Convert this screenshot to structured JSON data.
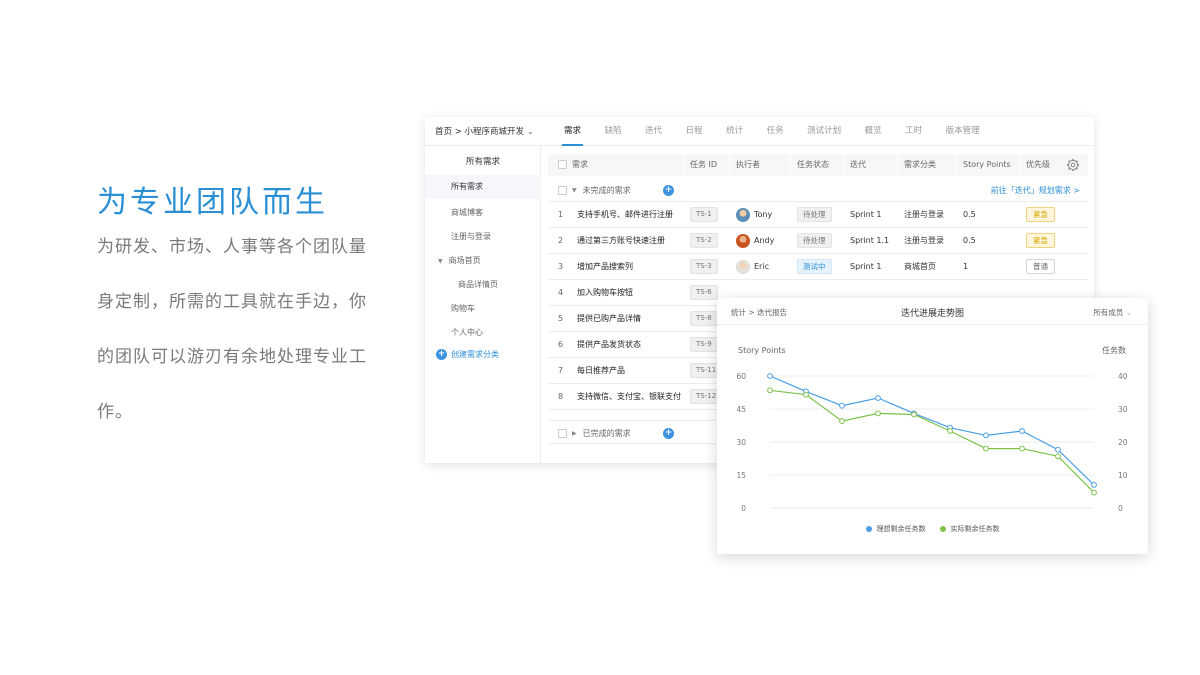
{
  "hero": {
    "title": "为专业团队而生",
    "body": "为研发、市场、人事等各个团队量身定制，所需的工具就在手边，你的团队可以游刃有余地处理专业工作。"
  },
  "app": {
    "project_breadcrumb": "首页 > 小程序商城开发",
    "nav_tabs": [
      "需求",
      "缺陷",
      "迭代",
      "日程",
      "统计",
      "任务",
      "测试计划",
      "概览",
      "工时",
      "版本管理"
    ],
    "active_tab": "需求",
    "sidebar": {
      "header": "所有需求",
      "items": [
        "所有需求",
        "商城博客",
        "注册与登录",
        "商场首页",
        "商品详情页",
        "购物车",
        "个人中心"
      ],
      "add_label": "创建需求分类"
    },
    "table": {
      "headers": [
        "需求",
        "任务 ID",
        "执行者",
        "任务状态",
        "迭代",
        "需求分类",
        "Story Points",
        "优先级"
      ],
      "group_incomplete": "未完成的需求",
      "group_link": "前往「迭代」规划需求 >",
      "group_complete": "已完成的需求",
      "rows": [
        {
          "no": "1",
          "name": "支持手机号、邮件进行注册",
          "id": "TS-1",
          "assignee": "Tony",
          "status": "待处理",
          "sprint": "Sprint 1",
          "category": "注册与登录",
          "points": "0.5",
          "priority": "紧急"
        },
        {
          "no": "2",
          "name": "通过第三方账号快速注册",
          "id": "TS-2",
          "assignee": "Andy",
          "status": "待处理",
          "sprint": "Sprint 1.1",
          "category": "注册与登录",
          "points": "0.5",
          "priority": "紧急"
        },
        {
          "no": "3",
          "name": "增加产品搜索列",
          "id": "TS-3",
          "assignee": "Eric",
          "status": "测试中",
          "sprint": "Sprint 1",
          "category": "商城首页",
          "points": "1",
          "priority": "普通"
        },
        {
          "no": "4",
          "name": "加入购物车按钮",
          "id": "TS-6"
        },
        {
          "no": "5",
          "name": "提供已购产品详情",
          "id": "TS-8"
        },
        {
          "no": "6",
          "name": "提供产品发货状态",
          "id": "TS-9"
        },
        {
          "no": "7",
          "name": "每日推荐产品",
          "id": "TS-11"
        },
        {
          "no": "8",
          "name": "支持微信、支付宝、银联支付",
          "id": "TS-12"
        }
      ]
    }
  },
  "chart_card": {
    "breadcrumb": "统计 > 迭代报告",
    "title": "迭代进展走势图",
    "filter": "所有成员"
  },
  "chart_data": {
    "type": "line",
    "title": "迭代进展走势图",
    "ylabel": "Story Points",
    "y2label": "任务数",
    "ylim": [
      0,
      60
    ],
    "y2lim": [
      0,
      40
    ],
    "yticks": [
      0,
      15,
      30,
      45,
      60
    ],
    "y2ticks": [
      0,
      10,
      20,
      30,
      40
    ],
    "x": [
      1,
      2,
      3,
      4,
      5,
      6,
      7,
      8,
      9,
      10
    ],
    "grid": true,
    "legend": "bottom",
    "series": [
      {
        "name": "理想剩余任务数",
        "color": "#4a9fe6",
        "values": [
          60,
          53,
          46.5,
          50,
          43,
          36.5,
          33,
          35,
          26.5,
          10.5
        ]
      },
      {
        "name": "实际剩余任务数",
        "color": "#7cc249",
        "values": [
          53.5,
          51.5,
          39.5,
          43,
          42.5,
          35,
          27,
          27,
          23.5,
          7
        ]
      }
    ]
  },
  "colors": {
    "accent": "#2b8fd6",
    "urgent": "#d9a400",
    "series_ideal": "#4a9fe6",
    "series_actual": "#7cc249"
  }
}
